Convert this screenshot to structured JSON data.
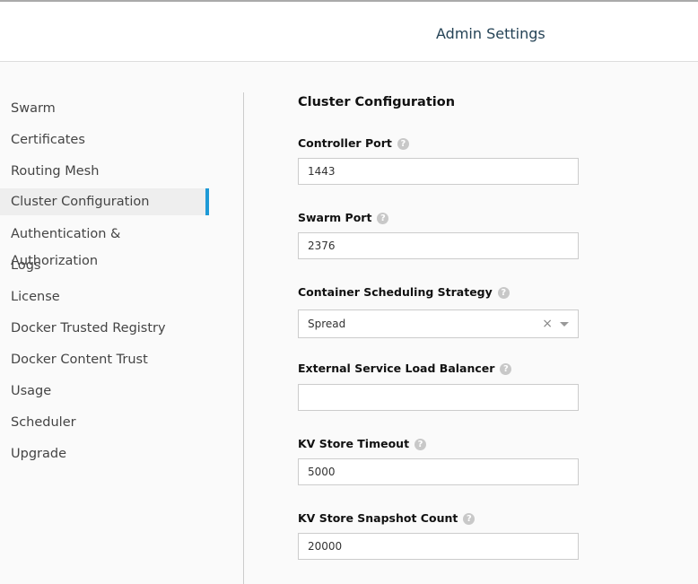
{
  "header": {
    "title": "Admin Settings"
  },
  "sidebar": {
    "items": [
      {
        "label": "Swarm"
      },
      {
        "label": "Certificates"
      },
      {
        "label": "Routing Mesh"
      },
      {
        "label": "Cluster Configuration",
        "active": true
      },
      {
        "label": "Authentication & Authorization"
      },
      {
        "label": "Logs"
      },
      {
        "label": "License"
      },
      {
        "label": "Docker Trusted Registry"
      },
      {
        "label": "Docker Content Trust"
      },
      {
        "label": "Usage"
      },
      {
        "label": "Scheduler"
      },
      {
        "label": "Upgrade"
      }
    ]
  },
  "main": {
    "title": "Cluster Configuration",
    "fields": [
      {
        "label": "Controller Port",
        "value": "1443"
      },
      {
        "label": "Swarm Port",
        "value": "2376"
      },
      {
        "label": "Container Scheduling Strategy",
        "value": "Spread"
      },
      {
        "label": "External Service Load Balancer",
        "value": ""
      },
      {
        "label": "KV Store Timeout",
        "value": "5000"
      },
      {
        "label": "KV Store Snapshot Count",
        "value": "20000"
      }
    ],
    "help_glyph": "?",
    "clear_glyph": "×"
  },
  "colors": {
    "accent": "#1e9ad6",
    "header_title": "#254356"
  }
}
